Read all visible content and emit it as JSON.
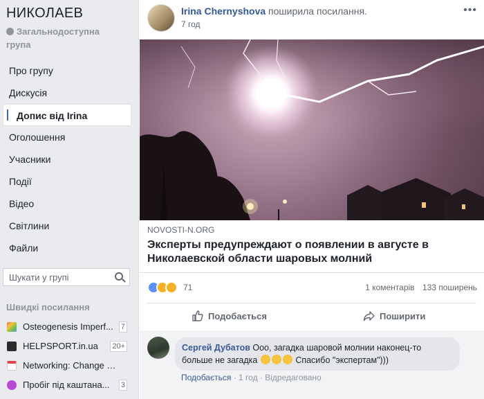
{
  "sidebar": {
    "group_name": "НИКОЛАЕВ",
    "privacy": "Загальнодоступна група",
    "nav": [
      {
        "label": "Про групу"
      },
      {
        "label": "Дискусія"
      },
      {
        "label": "Допис від Irina",
        "active": true
      },
      {
        "label": "Оголошення"
      },
      {
        "label": "Учасники"
      },
      {
        "label": "Події"
      },
      {
        "label": "Відео"
      },
      {
        "label": "Світлини"
      },
      {
        "label": "Файли"
      }
    ],
    "search_placeholder": "Шукати у групі",
    "quick_links_title": "Швидкі посилання",
    "quick_links": [
      {
        "label": "Osteogenesis Imperf...",
        "badge": "7",
        "icon_color": "#f36f4e"
      },
      {
        "label": "HELPSPORT.in.ua",
        "badge": "20+",
        "icon_color": "#2b2b2b"
      },
      {
        "label": "Networking: Change M...",
        "badge": "",
        "icon_color": "#e7e7e7"
      },
      {
        "label": "Пробіг під каштана...",
        "badge": "3",
        "icon_color": "#b84bd6"
      }
    ]
  },
  "post": {
    "author": "Irina Chernyshova",
    "action": "поширила посилання.",
    "time": "7 год",
    "more_icon": "•••",
    "link_domain": "NOVOSTI-N.ORG",
    "link_title": "Эксперты предупреждают о появлении в августе в Николаевской области шаровых молний",
    "reaction_count": "71",
    "comments": "1 коментарів",
    "shares": "133 поширень",
    "like_label": "Подобається",
    "share_label": "Поширити"
  },
  "comment": {
    "author": "Сергей Дубатов",
    "text_before": "Ооо, загадка шаровой молнии наконец-то больше не загадка",
    "text_after": "Спасибо \"экспертам\")))",
    "like_link": "Подобається",
    "sep1": " · ",
    "time": "1 год",
    "sep2": " · ",
    "edited": "Відредаговано"
  },
  "colors": {
    "link_blue": "#365899",
    "accent": "#4267b2",
    "background": "#e9ebee"
  }
}
